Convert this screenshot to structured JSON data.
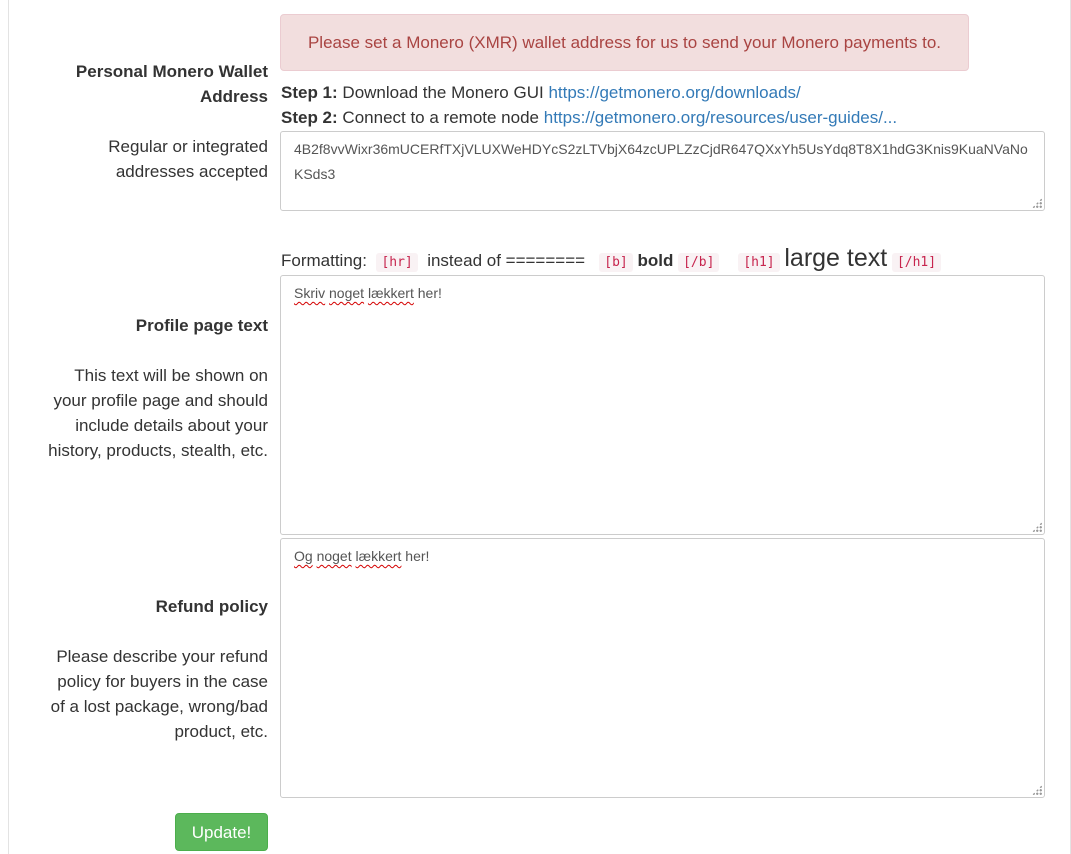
{
  "wallet": {
    "label_line1": "Personal Monero Wallet",
    "label_line2": "Address",
    "alert": "Please set a Monero (XMR) wallet address for us to send your Monero payments to.",
    "step1_prefix": "Step 1:",
    "step1_text": "Download the Monero GUI",
    "step1_link": "https://getmonero.org/downloads/",
    "step2_prefix": "Step 2:",
    "step2_text": "Connect to a remote node",
    "step2_link": "https://getmonero.org/resources/user-guides/...",
    "hint_line1": "Regular or integrated",
    "hint_line2": "addresses accepted",
    "address_value": "4B2f8vvWixr36mUCERfTXjVLUXWeHDYcS2zLTVbjX64zcUPLZzCjdR647QXxYh5UsYdq8T8X1hdG3Knis9KuaNVaNoKSds3"
  },
  "formatting": {
    "label": "Formatting:",
    "hr_tag": "[hr]",
    "instead_of": "instead of ========",
    "b_open": "[b]",
    "bold_text": "bold",
    "b_close": "[/b]",
    "h1_open": "[h1]",
    "large_text": "large text",
    "h1_close": "[/h1]"
  },
  "profile": {
    "title": "Profile page text",
    "desc_line1": "This text will be shown on",
    "desc_line2": "your profile page and should",
    "desc_line3": "include details about your",
    "desc_line4": "history, products, stealth, etc.",
    "value_word1": "Skriv",
    "value_word2": "noget",
    "value_word3": "lækkert",
    "value_rest": " her!"
  },
  "refund": {
    "title": "Refund policy",
    "desc_line1": "Please describe your refund",
    "desc_line2": "policy for buyers in the case",
    "desc_line3": "of a lost package, wrong/bad",
    "desc_line4": "product, etc.",
    "value_word1": "Og",
    "value_word2": "noget",
    "value_word3": "lækkert",
    "value_rest": " her!"
  },
  "submit": {
    "label": "Update!"
  },
  "colors": {
    "alert_bg": "#f2dede",
    "alert_text": "#a94442",
    "link": "#337ab7",
    "button": "#5cb85c",
    "code": "#c7254e"
  }
}
